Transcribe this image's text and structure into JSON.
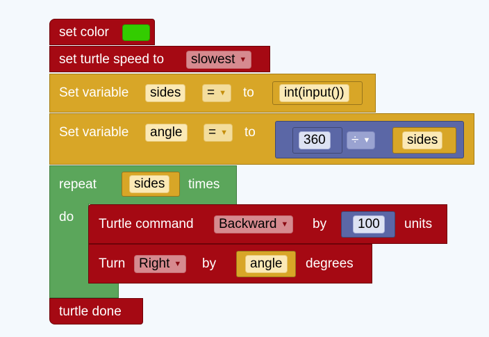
{
  "blocks": {
    "set_color": {
      "label": "set color",
      "color_value": "#33cc00"
    },
    "set_speed": {
      "label": "set turtle speed to",
      "value": "slowest"
    },
    "set_sides": {
      "label": "Set variable",
      "variable": "sides",
      "operator": "=",
      "to": "to",
      "expr": "int(input())"
    },
    "set_angle": {
      "label": "Set variable",
      "variable": "angle",
      "operator": "=",
      "to": "to",
      "dividend": "360",
      "divide_op": "÷",
      "divisor": "sides"
    },
    "repeat": {
      "label": "repeat",
      "count_var": "sides",
      "times": "times",
      "do": "do"
    },
    "turtle_command": {
      "label": "Turtle command",
      "direction": "Backward",
      "by": "by",
      "amount": "100",
      "units": "units"
    },
    "turn": {
      "label": "Turn",
      "direction": "Right",
      "by": "by",
      "variable": "angle",
      "degrees": "degrees"
    },
    "done": {
      "label": "turtle done"
    }
  },
  "colors": {
    "red_block": "#a50913",
    "gold_block": "#d8a627",
    "green_block": "#5ba65b",
    "blue_block": "#5b67a6"
  }
}
